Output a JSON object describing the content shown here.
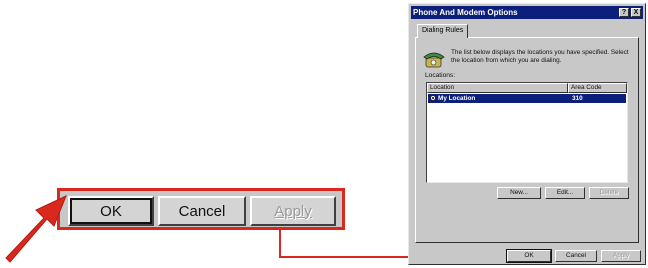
{
  "zoom_callout": {
    "ok_label": "OK",
    "cancel_label": "Cancel",
    "apply_label": "Apply"
  },
  "dialog": {
    "title": "Phone And Modem Options",
    "help_button": "?",
    "close_button": "X",
    "tab_label": "Dialing Rules",
    "description": "The list below displays the locations you have specified. Select the location from which you are dialing.",
    "locations_label": "Locations:",
    "columns": [
      "Location",
      "Area Code"
    ],
    "rows": [
      {
        "location": "My Location",
        "area_code": "310",
        "selected": true
      }
    ],
    "new_label": "New...",
    "edit_label": "Edit...",
    "delete_label": "Delete",
    "ok_label": "OK",
    "cancel_label": "Cancel",
    "apply_label": "Apply"
  },
  "colors": {
    "callout_red": "#d9291f",
    "titlebar_blue": "#0c1f7a",
    "dialog_gray": "#c8c8c8"
  }
}
